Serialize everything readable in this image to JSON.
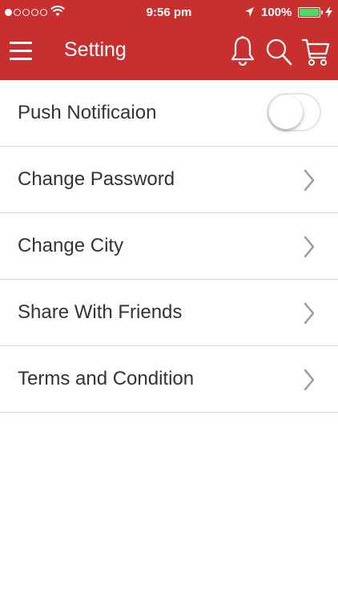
{
  "status_bar": {
    "time": "9:56 pm",
    "battery_percent": "100%",
    "signal_bars_filled": 1,
    "signal_bars_total": 5,
    "battery_level": 1.0,
    "battery_color": "#4cd964"
  },
  "header": {
    "title": "Setting",
    "background_color": "#c8302f",
    "icons": [
      "menu-icon",
      "bell-icon",
      "search-icon",
      "cart-icon"
    ]
  },
  "settings": {
    "push_notification": {
      "label": "Push Notificaion",
      "enabled": false
    },
    "items": [
      {
        "label": "Change Password",
        "icon": "chevron-right-icon"
      },
      {
        "label": "Change City",
        "icon": "chevron-right-icon"
      },
      {
        "label": "Share With Friends",
        "icon": "chevron-right-icon"
      },
      {
        "label": "Terms and Condition",
        "icon": "chevron-right-icon"
      }
    ]
  }
}
